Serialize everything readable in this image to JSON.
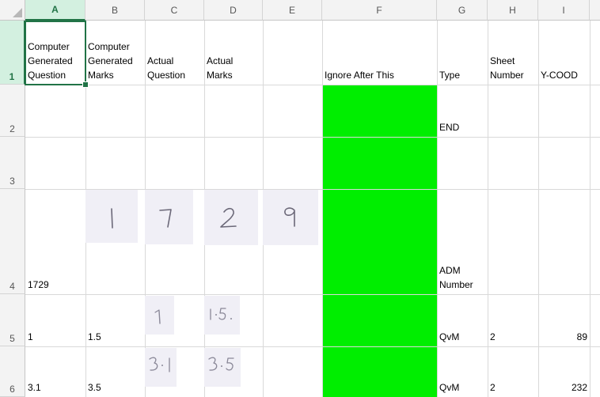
{
  "columns": [
    "A",
    "B",
    "C",
    "D",
    "E",
    "F",
    "G",
    "H",
    "I"
  ],
  "selected_column": "A",
  "rows": [
    "1",
    "2",
    "3",
    "4",
    "5",
    "6"
  ],
  "selected_row": "1",
  "headers": {
    "A": [
      "Computer",
      "Generated",
      "Question"
    ],
    "B": [
      "Computer",
      "Generated",
      "Marks"
    ],
    "C": [
      "Actual",
      "Question"
    ],
    "D": [
      "Actual",
      "Marks"
    ],
    "F": [
      "Ignore After This"
    ],
    "G": [
      "Type"
    ],
    "H": [
      "Sheet",
      "Number"
    ],
    "I": [
      "Y-COOD"
    ]
  },
  "cells": {
    "G2": "END",
    "A4": "1729",
    "G4": [
      "ADM",
      "Number"
    ],
    "A5": "1",
    "B5": "1.5",
    "G5": "QvM",
    "H5": "2",
    "I5": "89",
    "A6": "3.1",
    "B6": "3.5",
    "G6": "QvM",
    "H6": "2",
    "I6": "232"
  },
  "handwriting": {
    "row4": [
      "1",
      "7",
      "2",
      "9"
    ],
    "row5": [
      "1",
      "1.5"
    ],
    "row6": [
      "3.1",
      "3.5"
    ]
  },
  "colors": {
    "ignore_fill": "#00ee00",
    "selection": "#217346"
  }
}
